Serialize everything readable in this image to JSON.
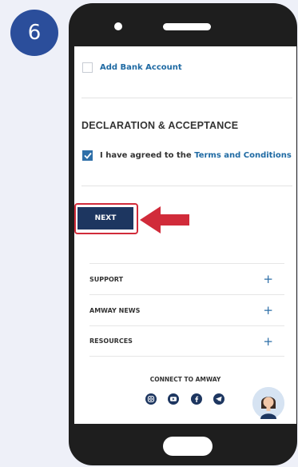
{
  "step": {
    "number": "6"
  },
  "form": {
    "add_bank_account": "Add Bank Account",
    "declaration_heading": "DECLARATION & ACCEPTANCE",
    "agree_prefix": "I have agreed to the ",
    "agree_link": "Terms and Conditions",
    "agree_checked": true,
    "next_label": "NEXT"
  },
  "footer": {
    "accordion": [
      {
        "label": "SUPPORT",
        "icon": "plus-icon"
      },
      {
        "label": "AMWAY NEWS",
        "icon": "plus-icon"
      },
      {
        "label": "RESOURCES",
        "icon": "plus-icon"
      }
    ],
    "connect_label": "CONNECT TO AMWAY",
    "social_icons": [
      "instagram-icon",
      "youtube-icon",
      "facebook-icon",
      "telegram-icon"
    ]
  },
  "colors": {
    "accent_blue": "#2e6fa8",
    "next_button": "#1d3660",
    "highlight_red": "#d12b3a",
    "step_badge": "#2b4e9b"
  }
}
